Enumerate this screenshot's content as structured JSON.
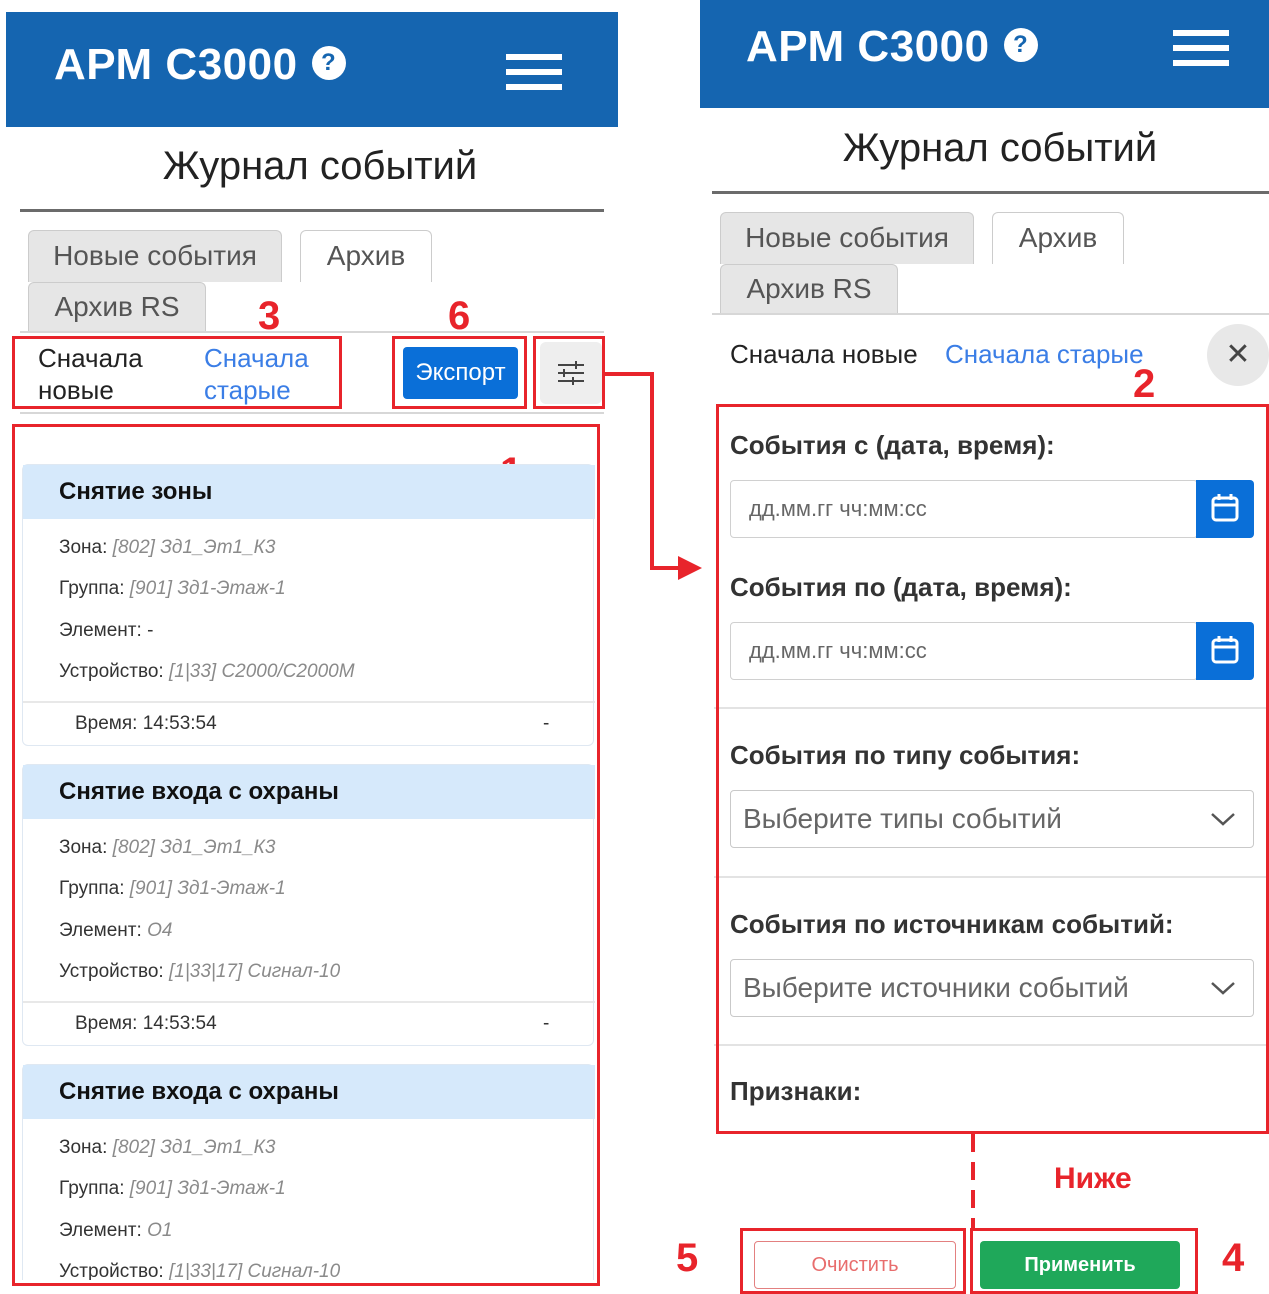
{
  "app": {
    "title": "АРМ С3000",
    "help_glyph": "?"
  },
  "page": {
    "title": "Журнал событий"
  },
  "tabs": [
    {
      "label": "Новые события",
      "active": false
    },
    {
      "label": "Архив",
      "active": true
    },
    {
      "label": "Архив RS",
      "active": false
    }
  ],
  "sort": {
    "newest_left": "Сначала\nновые",
    "oldest_left": "Сначала\nстарые",
    "newest": "Сначала новые",
    "oldest": "Сначала старые"
  },
  "toolbar": {
    "export_label": "Экспорт"
  },
  "events": [
    {
      "title": "Снятие зоны",
      "zone_label": "Зона:",
      "zone": "[802] Зд1_Эт1_К3",
      "group_label": "Группа:",
      "group": "[901] Зд1-Этаж-1",
      "element_label": "Элемент:",
      "element": "-",
      "device_label": "Устройство:",
      "device": "[1|33] С2000/С2000М",
      "time_label": "Время:",
      "time": "14:53:54",
      "extra": "-"
    },
    {
      "title": "Снятие входа с охраны",
      "zone_label": "Зона:",
      "zone": "[802] Зд1_Эт1_К3",
      "group_label": "Группа:",
      "group": "[901] Зд1-Этаж-1",
      "element_label": "Элемент:",
      "element": "О4",
      "device_label": "Устройство:",
      "device": "[1|33|17] Сигнал-10",
      "time_label": "Время:",
      "time": "14:53:54",
      "extra": "-"
    },
    {
      "title": "Снятие входа с охраны",
      "zone_label": "Зона:",
      "zone": "[802] Зд1_Эт1_К3",
      "group_label": "Группа:",
      "group": "[901] Зд1-Этаж-1",
      "element_label": "Элемент:",
      "element": "О1",
      "device_label": "Устройство:",
      "device": "[1|33|17] Сигнал-10"
    }
  ],
  "filters": {
    "from_label": "События с (дата, время):",
    "to_label": "События по (дата, время):",
    "datetime_placeholder": "дд.мм.гг чч:мм:сс",
    "type_label": "События по типу события:",
    "type_placeholder": "Выберите типы событий",
    "source_label": "События по источникам событий:",
    "source_placeholder": "Выберите источники событий",
    "flags_label": "Признаки:",
    "close_glyph": "✕"
  },
  "actions": {
    "clear_label": "Очистить",
    "apply_label": "Применить"
  },
  "annotations": {
    "n1": "1",
    "n2": "2",
    "n3": "3",
    "n4": "4",
    "n5": "5",
    "n6": "6",
    "below": "Ниже"
  },
  "colors": {
    "header_blue": "#1565b0",
    "accent_blue": "#0a6fd8",
    "link_blue": "#3b7ee6",
    "card_header": "#d6e9fb",
    "annotation_red": "#e8242b",
    "apply_green": "#1fa85a"
  }
}
